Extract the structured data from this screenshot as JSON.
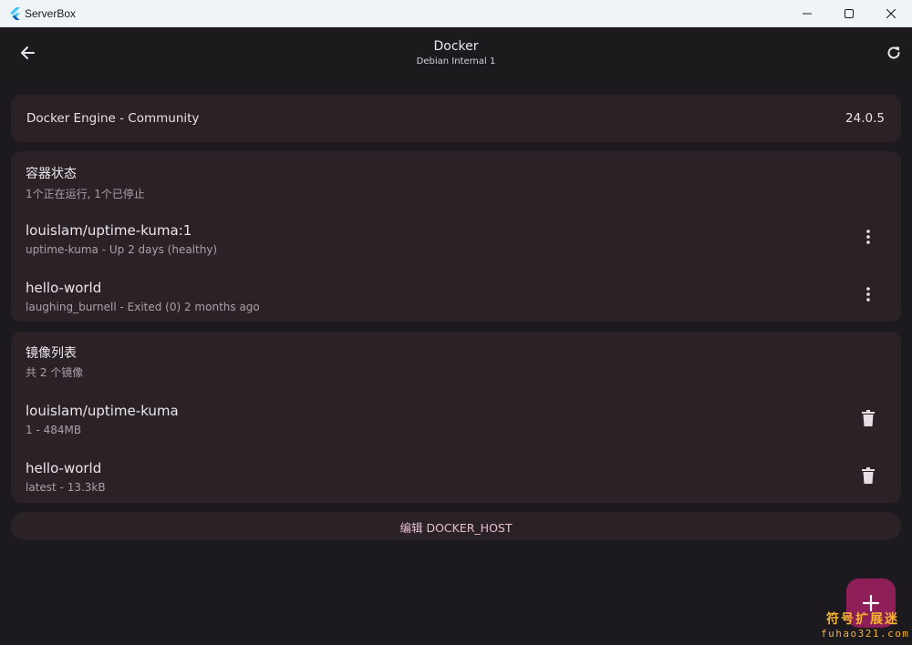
{
  "window": {
    "title": "ServerBox"
  },
  "appbar": {
    "title": "Docker",
    "subtitle": "Debian Internal 1"
  },
  "engine": {
    "name": "Docker Engine - Community",
    "version": "24.0.5"
  },
  "containers": {
    "title": "容器状态",
    "summary": "1个正在运行, 1个已停止",
    "items": [
      {
        "image": "louislam/uptime-kuma:1",
        "detail": "uptime-kuma - Up 2 days (healthy)"
      },
      {
        "image": "hello-world",
        "detail": "laughing_burnell - Exited (0) 2 months ago"
      }
    ]
  },
  "images": {
    "title": "镜像列表",
    "summary": "共 2 个镜像",
    "items": [
      {
        "name": "louislam/uptime-kuma",
        "detail": "1 - 484MB"
      },
      {
        "name": "hello-world",
        "detail": "latest - 13.3kB"
      }
    ]
  },
  "edit_button": {
    "label": "编辑 DOCKER_HOST"
  },
  "watermark": {
    "line1": "符号扩展迷",
    "line2": "fuhao321.com"
  },
  "icons": {
    "back": "arrow-back-icon",
    "refresh": "refresh-icon",
    "more": "more-vert-icon",
    "delete": "trash-icon",
    "add": "plus-icon"
  },
  "colors": {
    "background": "#1c1b1f",
    "card": "#2a2226",
    "fab": "#8e1e58",
    "accent_text": "#e9bfd3"
  }
}
